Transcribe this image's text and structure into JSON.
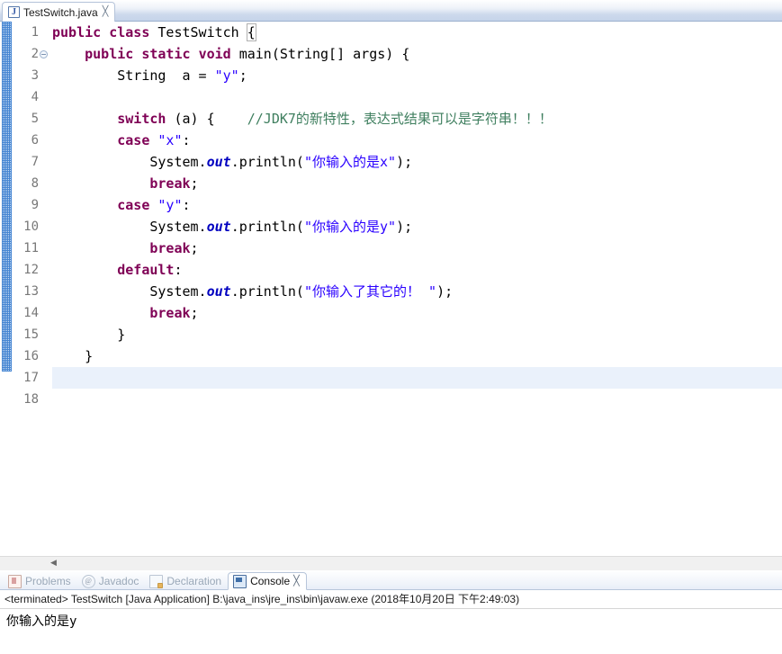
{
  "editor": {
    "tab": {
      "label": "TestSwitch.java",
      "icon": "java-file-icon",
      "icon_letter": "J",
      "close": "╳"
    },
    "line_numbers": [
      "1",
      "2",
      "3",
      "4",
      "5",
      "6",
      "7",
      "8",
      "9",
      "10",
      "11",
      "12",
      "13",
      "14",
      "15",
      "16",
      "17",
      "18"
    ],
    "current_line": 17,
    "code_lines": [
      {
        "n": 1,
        "tokens": [
          {
            "t": "public",
            "c": "kw"
          },
          {
            "t": " ",
            "c": ""
          },
          {
            "t": "class",
            "c": "kw"
          },
          {
            "t": " TestSwitch ",
            "c": ""
          },
          {
            "t": "{",
            "c": "brkt"
          }
        ]
      },
      {
        "n": 2,
        "tokens": [
          {
            "t": "    ",
            "c": ""
          },
          {
            "t": "public",
            "c": "kw"
          },
          {
            "t": " ",
            "c": ""
          },
          {
            "t": "static",
            "c": "kw"
          },
          {
            "t": " ",
            "c": ""
          },
          {
            "t": "void",
            "c": "kw"
          },
          {
            "t": " main(String[] args) {",
            "c": ""
          }
        ]
      },
      {
        "n": 3,
        "tokens": [
          {
            "t": "        String  a = ",
            "c": ""
          },
          {
            "t": "\"y\"",
            "c": "str"
          },
          {
            "t": ";",
            "c": ""
          }
        ]
      },
      {
        "n": 4,
        "tokens": [
          {
            "t": "",
            "c": ""
          }
        ]
      },
      {
        "n": 5,
        "tokens": [
          {
            "t": "        ",
            "c": ""
          },
          {
            "t": "switch",
            "c": "kw"
          },
          {
            "t": " (a) {    ",
            "c": ""
          },
          {
            "t": "//JDK7的新特性，表达式结果可以是字符串！！！",
            "c": "cmt"
          }
        ]
      },
      {
        "n": 6,
        "tokens": [
          {
            "t": "        ",
            "c": ""
          },
          {
            "t": "case",
            "c": "kw"
          },
          {
            "t": " ",
            "c": ""
          },
          {
            "t": "\"x\"",
            "c": "str"
          },
          {
            "t": ":",
            "c": ""
          }
        ]
      },
      {
        "n": 7,
        "tokens": [
          {
            "t": "            System.",
            "c": ""
          },
          {
            "t": "out",
            "c": "fld"
          },
          {
            "t": ".println(",
            "c": ""
          },
          {
            "t": "\"你输入的是x\"",
            "c": "str"
          },
          {
            "t": ");",
            "c": ""
          }
        ]
      },
      {
        "n": 8,
        "tokens": [
          {
            "t": "            ",
            "c": ""
          },
          {
            "t": "break",
            "c": "kw"
          },
          {
            "t": ";",
            "c": ""
          }
        ]
      },
      {
        "n": 9,
        "tokens": [
          {
            "t": "        ",
            "c": ""
          },
          {
            "t": "case",
            "c": "kw"
          },
          {
            "t": " ",
            "c": ""
          },
          {
            "t": "\"y\"",
            "c": "str"
          },
          {
            "t": ":",
            "c": ""
          }
        ]
      },
      {
        "n": 10,
        "tokens": [
          {
            "t": "            System.",
            "c": ""
          },
          {
            "t": "out",
            "c": "fld"
          },
          {
            "t": ".println(",
            "c": ""
          },
          {
            "t": "\"你输入的是y\"",
            "c": "str"
          },
          {
            "t": ");",
            "c": ""
          }
        ]
      },
      {
        "n": 11,
        "tokens": [
          {
            "t": "            ",
            "c": ""
          },
          {
            "t": "break",
            "c": "kw"
          },
          {
            "t": ";",
            "c": ""
          }
        ]
      },
      {
        "n": 12,
        "tokens": [
          {
            "t": "        ",
            "c": ""
          },
          {
            "t": "default",
            "c": "kw"
          },
          {
            "t": ":",
            "c": ""
          }
        ]
      },
      {
        "n": 13,
        "tokens": [
          {
            "t": "            System.",
            "c": ""
          },
          {
            "t": "out",
            "c": "fld"
          },
          {
            "t": ".println(",
            "c": ""
          },
          {
            "t": "\"你输入了其它的！ \"",
            "c": "str"
          },
          {
            "t": ");",
            "c": ""
          }
        ]
      },
      {
        "n": 14,
        "tokens": [
          {
            "t": "            ",
            "c": ""
          },
          {
            "t": "break",
            "c": "kw"
          },
          {
            "t": ";",
            "c": ""
          }
        ]
      },
      {
        "n": 15,
        "tokens": [
          {
            "t": "        }",
            "c": ""
          }
        ]
      },
      {
        "n": 16,
        "tokens": [
          {
            "t": "    }",
            "c": ""
          }
        ]
      },
      {
        "n": 17,
        "tokens": [
          {
            "t": "}",
            "c": ""
          }
        ]
      },
      {
        "n": 18,
        "tokens": [
          {
            "t": "",
            "c": ""
          }
        ]
      }
    ],
    "scroll_left_arrow": "◀"
  },
  "panel": {
    "tabs": [
      {
        "label": "Problems",
        "icon": "problems-icon",
        "active": false,
        "closable": false
      },
      {
        "label": "Javadoc",
        "icon": "javadoc-icon",
        "active": false,
        "closable": false
      },
      {
        "label": "Declaration",
        "icon": "declaration-icon",
        "active": false,
        "closable": false
      },
      {
        "label": "Console",
        "icon": "console-icon",
        "active": true,
        "closable": true
      }
    ],
    "close_glyph": "╳",
    "terminated_line": "<terminated> TestSwitch [Java Application] B:\\java_ins\\jre_ins\\bin\\javaw.exe (2018年10月20日 下午2:49:03)",
    "console_output": "你输入的是y"
  },
  "colors": {
    "keyword": "#7f0055",
    "string": "#2a00ff",
    "comment": "#3f7f5f",
    "field": "#0000c0",
    "current_line_highlight": "#eaf1fb",
    "tabbar_accent": "#c6d4ea"
  }
}
